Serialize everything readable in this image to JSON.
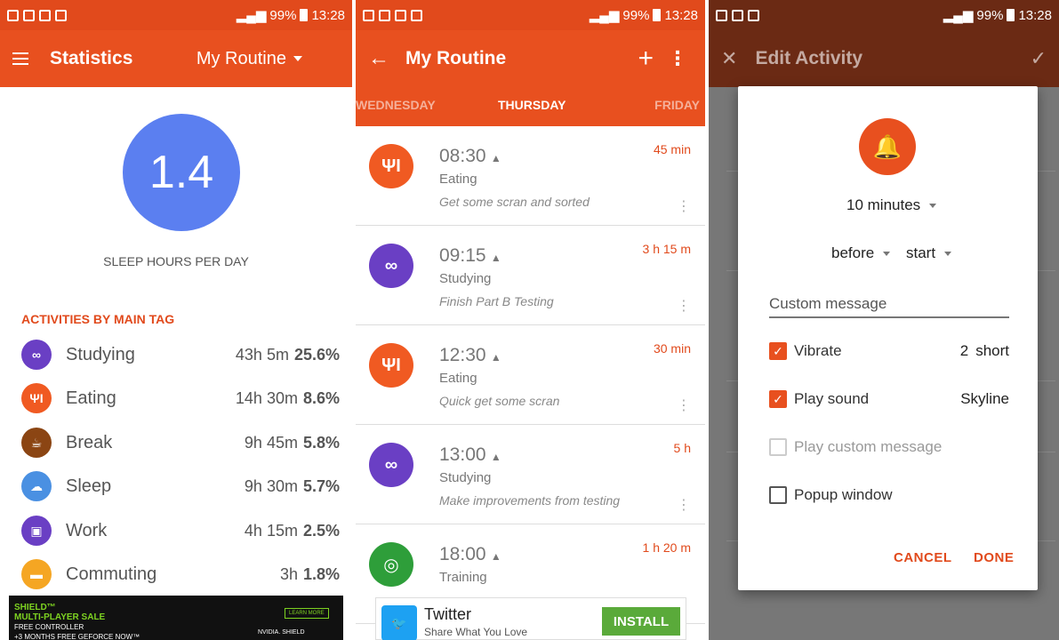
{
  "statusbar": {
    "battery": "99%",
    "time": "13:28"
  },
  "stats_panel": {
    "title": "Statistics",
    "routine_select": "My Routine",
    "sleep_value": "1.4",
    "sleep_label": "SLEEP HOURS PER DAY",
    "activities_header": "ACTIVITIES BY MAIN TAG",
    "activities": [
      {
        "name": "Studying",
        "time": "43h 5m",
        "pct": "25.6%",
        "color": "#6a3fc4",
        "icon": "glasses-icon"
      },
      {
        "name": "Eating",
        "time": "14h 30m",
        "pct": "8.6%",
        "color": "#f05a22",
        "icon": "fork-knife-icon"
      },
      {
        "name": "Break",
        "time": "9h 45m",
        "pct": "5.8%",
        "color": "#8b4513",
        "icon": "coffee-icon"
      },
      {
        "name": "Sleep",
        "time": "9h 30m",
        "pct": "5.7%",
        "color": "#4a90e2",
        "icon": "cloud-icon"
      },
      {
        "name": "Work",
        "time": "4h 15m",
        "pct": "2.5%",
        "color": "#6a3fc4",
        "icon": "briefcase-icon"
      },
      {
        "name": "Commuting",
        "time": "3h",
        "pct": "1.8%",
        "color": "#f5a623",
        "icon": "car-icon"
      }
    ],
    "ad": {
      "line1": "SHIELD™",
      "line2": "MULTI-PLAYER SALE",
      "line3": "FREE CONTROLLER",
      "line4": "+3 MONTHS FREE GEFORCE NOW™",
      "cta": "LEARN MORE",
      "brand": "NVIDIA. SHIELD"
    }
  },
  "routine_panel": {
    "title": "My Routine",
    "tabs": {
      "prev": "WEDNESDAY",
      "current": "THURSDAY",
      "next": "FRIDAY"
    },
    "items": [
      {
        "time": "08:30",
        "tag": "Eating",
        "note": "Get some scran and sorted",
        "duration": "45 min",
        "color": "#f05a22",
        "icon": "fork-knife-icon"
      },
      {
        "time": "09:15",
        "tag": "Studying",
        "note": "Finish Part B Testing",
        "duration": "3 h 15 m",
        "color": "#6a3fc4",
        "icon": "glasses-icon"
      },
      {
        "time": "12:30",
        "tag": "Eating",
        "note": "Quick get some scran",
        "duration": "30 min",
        "color": "#f05a22",
        "icon": "fork-knife-icon"
      },
      {
        "time": "13:00",
        "tag": "Studying",
        "note": "Make improvements from testing",
        "duration": "5 h",
        "color": "#6a3fc4",
        "icon": "glasses-icon"
      },
      {
        "time": "18:00",
        "tag": "Training",
        "note": "",
        "duration": "1 h 20 m",
        "color": "#2e9e3a",
        "icon": "basketball-icon"
      }
    ],
    "ad": {
      "name": "Twitter",
      "subtitle": "Share What You Love",
      "cta": "INSTALL"
    }
  },
  "edit_panel": {
    "title": "Edit Activity",
    "dialog": {
      "minutes": "10 minutes",
      "relation": "before",
      "anchor": "start",
      "custom_message_placeholder": "Custom message",
      "vibrate_label": "Vibrate",
      "vibrate_count": "2",
      "vibrate_type": "short",
      "play_sound_label": "Play sound",
      "sound_name": "Skyline",
      "play_custom_label": "Play custom message",
      "popup_label": "Popup window",
      "cancel": "CANCEL",
      "done": "DONE"
    }
  }
}
